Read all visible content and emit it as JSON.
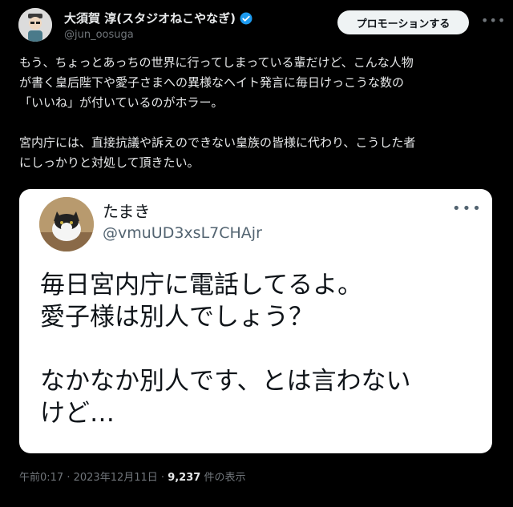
{
  "author": {
    "name": "大須賀 淳(スタジオねこやなぎ)",
    "handle": "@jun_oosuga",
    "verified_color": "#1d9bf0"
  },
  "header": {
    "promote_label": "プロモーションする",
    "more_icon": "more-icon"
  },
  "tweet": {
    "text": "もう、ちょっとあっちの世界に行ってしまっている輩だけど、こんな人物\nが書く皇后陛下や愛子さまへの異様なヘイト発言に毎日けっこうな数の\n「いいね」が付いているのがホラー。\n\n宮内庁には、直接抗議や訴えのできない皇族の皆様に代わり、こうした者\nにしっかりと対処して頂きたい。"
  },
  "quote": {
    "name": "たまき",
    "handle": "@vmuUD3xsL7CHAjr",
    "text": "毎日宮内庁に電話してるよ。\n愛子様は別人でしょう？\n\nなかなか別人です、とは言わない\nけど…"
  },
  "meta": {
    "time": "午前0:17",
    "sep": " · ",
    "date": "2023年12月11日",
    "views": "9,237",
    "views_label": " 件の表示"
  }
}
